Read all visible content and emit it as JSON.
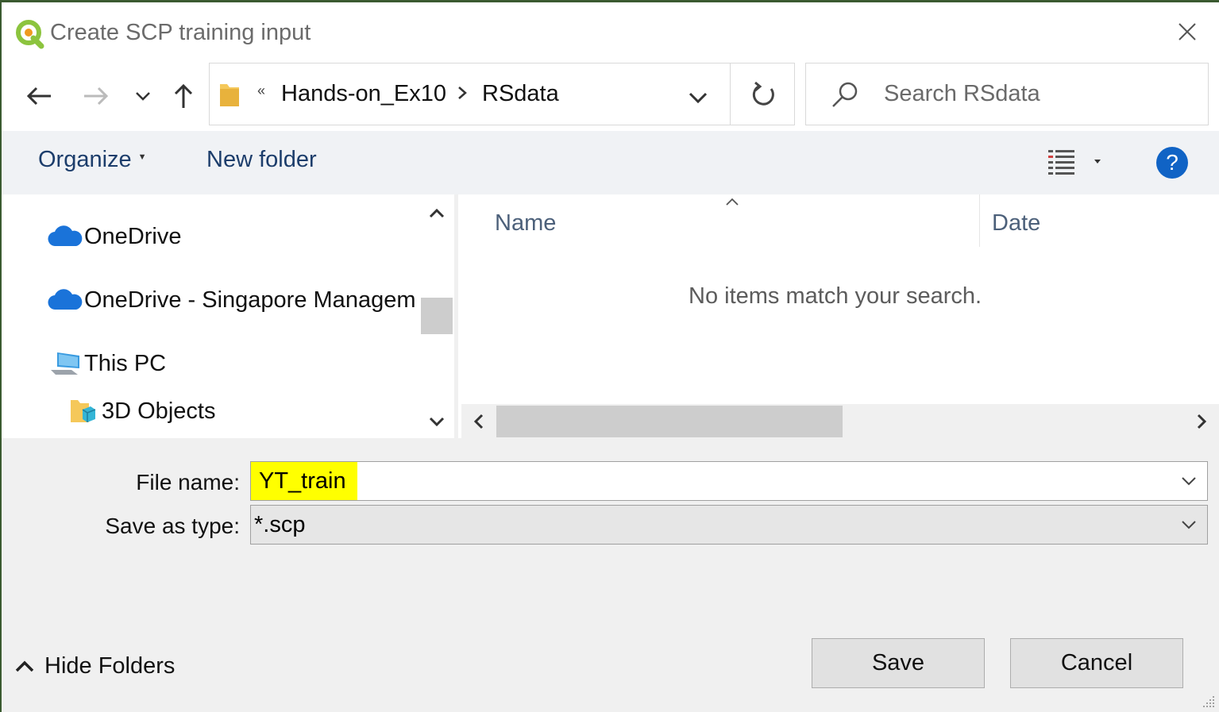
{
  "window": {
    "title": "Create SCP training input"
  },
  "address": {
    "overflow_chevron": "«",
    "segments": [
      "Hands-on_Ex10",
      "RSdata"
    ]
  },
  "search": {
    "placeholder": "Search RSdata"
  },
  "toolbar": {
    "organize_label": "Organize",
    "new_folder_label": "New folder",
    "help_label": "?"
  },
  "nav_tree": [
    {
      "label": "OneDrive",
      "icon": "onedrive-cloud-icon"
    },
    {
      "label": "OneDrive - Singapore Managem",
      "icon": "onedrive-cloud-icon"
    },
    {
      "label": "This PC",
      "icon": "computer-icon"
    },
    {
      "label": "3D Objects",
      "icon": "3d-objects-folder-icon"
    }
  ],
  "file_list": {
    "columns": [
      "Name",
      "Date"
    ],
    "empty_message": "No items match your search."
  },
  "file_name": {
    "label": "File name:",
    "value": "YT_train",
    "highlight_color": "#ffff00"
  },
  "save_type": {
    "label": "Save as type:",
    "value": "*.scp"
  },
  "footer": {
    "hide_folders_label": "Hide Folders",
    "save_label": "Save",
    "cancel_label": "Cancel"
  },
  "colors": {
    "help_blue": "#1063c5",
    "onedrive_blue": "#1a73d9",
    "qgis_green": "#8cc43e"
  }
}
